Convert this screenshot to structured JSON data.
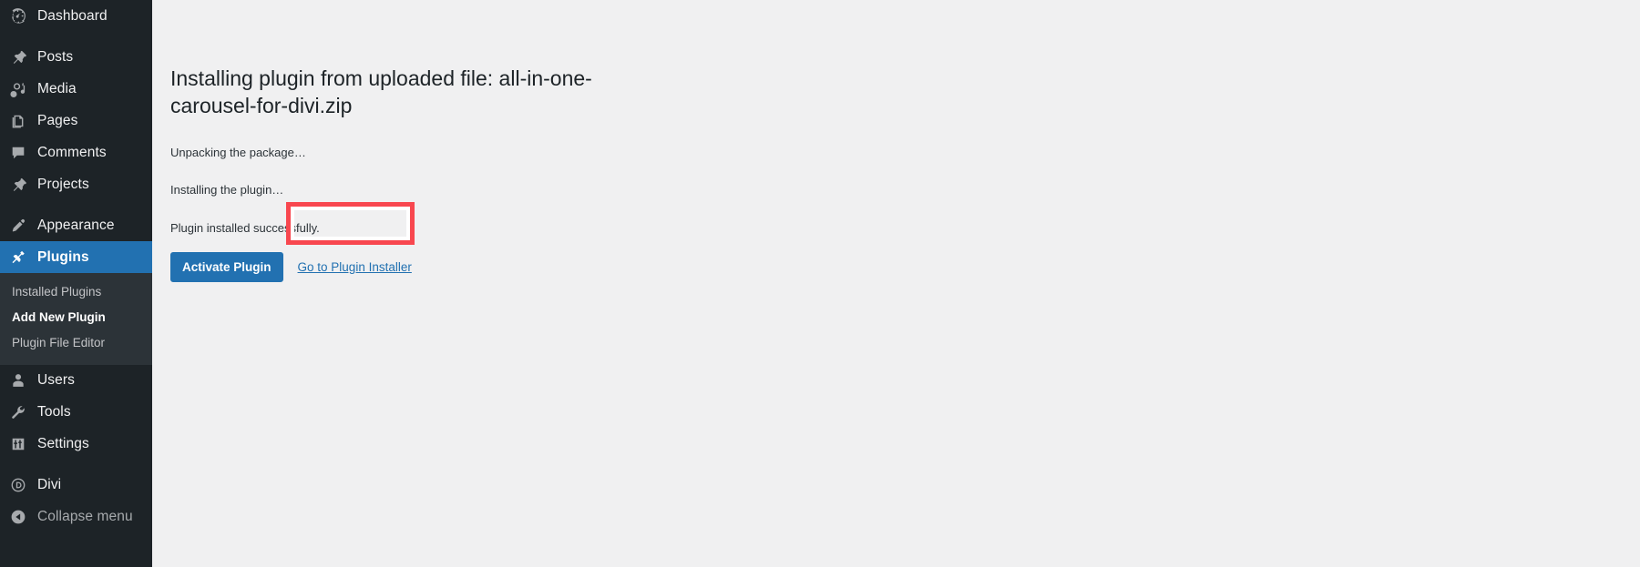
{
  "sidebar": {
    "groups": [
      {
        "items": [
          {
            "label": "Dashboard",
            "icon": "dashboard-icon",
            "state": "normal"
          }
        ]
      },
      {
        "items": [
          {
            "label": "Posts",
            "icon": "pin-icon",
            "state": "normal"
          },
          {
            "label": "Media",
            "icon": "media-icon",
            "state": "normal"
          },
          {
            "label": "Pages",
            "icon": "pages-icon",
            "state": "normal"
          },
          {
            "label": "Comments",
            "icon": "comments-icon",
            "state": "normal"
          },
          {
            "label": "Projects",
            "icon": "pin-icon",
            "state": "normal"
          }
        ]
      },
      {
        "items": [
          {
            "label": "Appearance",
            "icon": "paintbrush-icon",
            "state": "normal"
          },
          {
            "label": "Plugins",
            "icon": "plug-icon",
            "state": "current"
          }
        ]
      }
    ],
    "submenu": {
      "parent": "Plugins",
      "items": [
        {
          "label": "Installed Plugins",
          "current": false
        },
        {
          "label": "Add New Plugin",
          "current": true
        },
        {
          "label": "Plugin File Editor",
          "current": false
        }
      ]
    },
    "groups_after": [
      {
        "items": [
          {
            "label": "Users",
            "icon": "users-icon",
            "state": "normal"
          },
          {
            "label": "Tools",
            "icon": "wrench-icon",
            "state": "normal"
          },
          {
            "label": "Settings",
            "icon": "settings-icon",
            "state": "normal"
          }
        ]
      },
      {
        "items": [
          {
            "label": "Divi",
            "icon": "divi-icon",
            "state": "normal"
          },
          {
            "label": "Collapse menu",
            "icon": "collapse-icon",
            "state": "dim"
          }
        ]
      }
    ]
  },
  "main": {
    "title": "Installing plugin from uploaded file: all-in-one-carousel-for-divi.zip",
    "status_messages": [
      "Unpacking the package…",
      "Installing the plugin…",
      "Plugin installed successfully."
    ],
    "activate_button": "Activate Plugin",
    "installer_link": "Go to Plugin Installer"
  },
  "colors": {
    "sidebar_bg": "#1d2327",
    "submenu_bg": "#2c3338",
    "accent_blue": "#2271b1",
    "content_bg": "#f0f0f1",
    "highlight_red": "#f8474f",
    "text_primary": "#1d2327",
    "text_muted": "#a7aaad"
  }
}
